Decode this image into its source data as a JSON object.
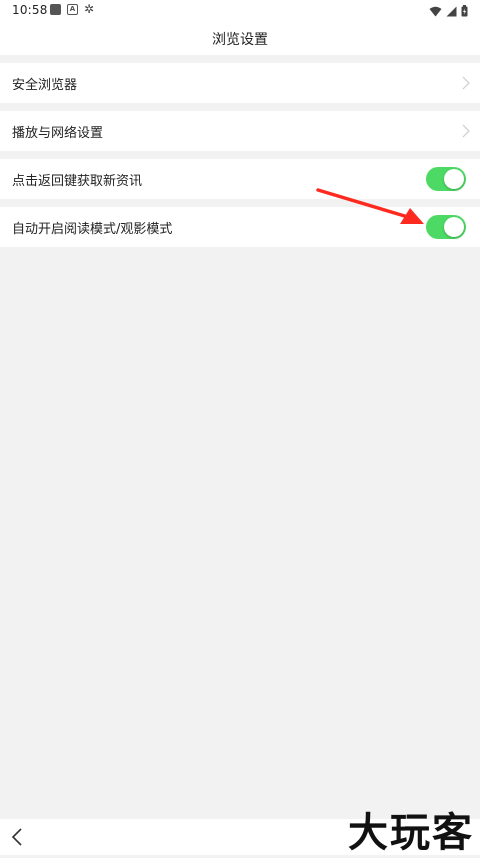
{
  "status_bar": {
    "time": "10:58",
    "notification_icons": [
      "square-notification-icon",
      "a-box-notification-icon",
      "bug-icon"
    ],
    "right_icons": [
      "wifi-icon",
      "signal-icon",
      "battery-icon"
    ]
  },
  "header": {
    "title": "浏览设置"
  },
  "settings": {
    "rows": [
      {
        "label": "安全浏览器",
        "control": "chevron"
      },
      {
        "label": "播放与网络设置",
        "control": "chevron"
      },
      {
        "label": "点击返回键获取新资讯",
        "control": "toggle",
        "enabled": true
      },
      {
        "label": "自动开启阅读模式/观影模式",
        "control": "toggle",
        "enabled": true
      }
    ]
  },
  "colors": {
    "toggle_on": "#4cd964",
    "annotation_arrow": "#ff2a1f",
    "background": "#f2f2f2"
  },
  "bottom_bar": {
    "back_icon": "chevron-left-icon"
  },
  "watermark": {
    "text": "大玩客"
  }
}
